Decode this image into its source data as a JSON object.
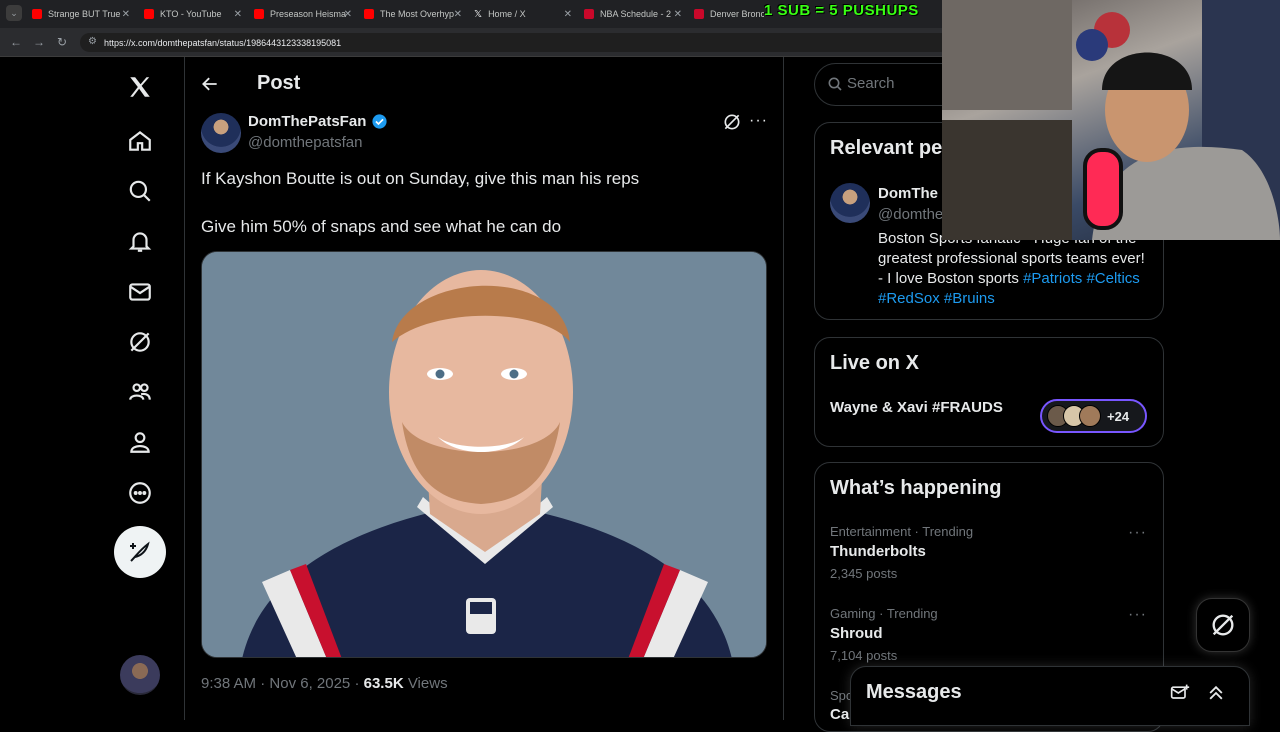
{
  "browser": {
    "tabs": [
      {
        "title": "Strange BUT True",
        "color": "#ff0000"
      },
      {
        "title": "KTO - YouTube",
        "color": "#ff0000"
      },
      {
        "title": "Preseason Heisma",
        "color": "#ff0000"
      },
      {
        "title": "The Most Overhyp",
        "color": "#ff0000"
      },
      {
        "title": "Home / X",
        "color": "#e7e9ea"
      },
      {
        "title": "NBA Schedule - 2",
        "color": "#c9082a"
      },
      {
        "title": "Denver Broncos",
        "color": "#c9082a"
      }
    ],
    "url": "https://x.com/domthepatsfan/status/1986443123338195081"
  },
  "stream_overlay": "1 SUB = 5 PUSHUPS",
  "nav": {
    "icons": [
      "x-logo-icon",
      "home-icon",
      "explore-icon",
      "notifications-icon",
      "messages-icon",
      "grok-icon",
      "communities-icon",
      "profile-icon",
      "more-icon",
      "compose-post-icon"
    ]
  },
  "post": {
    "header_title": "Post",
    "author_name": "DomThePatsFan",
    "author_handle": "@domthepatsfan",
    "line1": "If Kayshon Boutte is out on Sunday, give this man his reps",
    "line2": "Give him 50% of snaps and see what he can do",
    "time": "9:38 AM",
    "date": "Nov 6, 2025",
    "views_count": "63.5K",
    "views_label": "Views"
  },
  "sidebar": {
    "search_placeholder": "Search",
    "relevant": {
      "title": "Relevant pe",
      "name": "DomThe",
      "handle": "@domthe",
      "bio_text": "Boston Sports fanatic - Huge fan of the greatest professional sports teams ever! - I love Boston sports",
      "hashtags": [
        "#Patriots",
        "#Celtics",
        "#RedSox",
        "#Bruins"
      ]
    },
    "live": {
      "title": "Live on X",
      "space_title": "Wayne & Xavi #FRAUDS",
      "listener_extra": "+24"
    },
    "happening": {
      "title": "What’s happening",
      "trends": [
        {
          "category": "Entertainment · Trending",
          "name": "Thunderbolts",
          "count": "2,345 posts"
        },
        {
          "category": "Gaming · Trending",
          "name": "Shroud",
          "count": "7,104 posts"
        },
        {
          "category": "Spo",
          "name": "Ca",
          "count": ""
        }
      ]
    },
    "messages_title": "Messages"
  },
  "colors": {
    "accent": "#1d9bf0",
    "overlay_green": "#39ff14",
    "live_purple": "#7856ff"
  }
}
